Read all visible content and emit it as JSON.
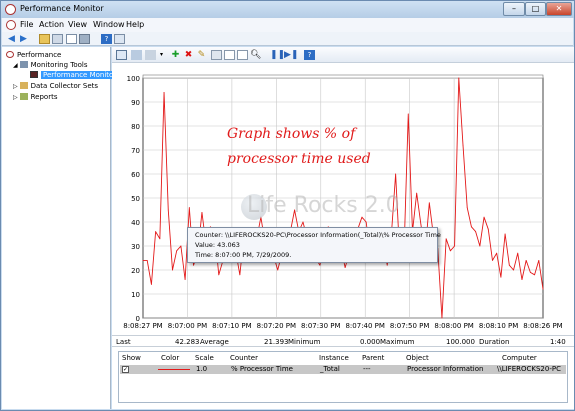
{
  "window": {
    "title": "Performance Monitor",
    "controls": {
      "minimize": "–",
      "maximize": "□",
      "close": "✕"
    }
  },
  "menu": [
    "File",
    "Action",
    "View",
    "Window",
    "Help"
  ],
  "tree": {
    "items": [
      {
        "label": "Performance",
        "level": 0
      },
      {
        "label": "Monitoring Tools",
        "level": 1
      },
      {
        "label": "Performance Monitor",
        "level": 2,
        "selected": true
      },
      {
        "label": "Data Collector Sets",
        "level": 1
      },
      {
        "label": "Reports",
        "level": 1
      }
    ]
  },
  "chart_data": {
    "type": "line",
    "ylim": [
      0,
      100
    ],
    "yticks": [
      0,
      10,
      20,
      30,
      40,
      50,
      60,
      70,
      80,
      90,
      100
    ],
    "x_ticks": [
      "8:08:27 PM",
      "8:07:00 PM",
      "8:07:10 PM",
      "8:07:20 PM",
      "8:07:30 PM",
      "8:07:40 PM",
      "8:07:50 PM",
      "8:08:00 PM",
      "8:08:10 PM",
      "8:08:26 PM"
    ],
    "series": [
      {
        "color": "#e31919",
        "values": [
          24,
          24,
          14,
          36,
          33,
          94,
          45,
          20,
          28,
          30,
          16,
          46,
          22,
          27,
          44,
          30,
          38,
          36,
          18,
          24,
          26,
          25,
          28,
          18,
          35,
          26,
          29,
          33,
          42,
          31,
          25,
          26,
          20,
          27,
          33,
          36,
          45,
          36,
          40,
          33,
          32,
          25,
          22,
          30,
          38,
          28,
          37,
          30,
          21,
          27,
          35,
          37,
          42,
          40,
          26,
          29,
          25,
          32,
          22,
          35,
          60,
          25,
          28,
          85,
          36,
          52,
          39,
          27,
          48,
          34,
          29,
          0,
          33,
          28,
          30,
          100,
          72,
          46,
          38,
          36,
          30,
          42,
          37,
          24,
          27,
          17,
          35,
          22,
          20,
          27,
          16,
          24,
          19,
          18,
          24,
          12
        ]
      }
    ]
  },
  "annotation": {
    "line1": "Graph shows % of",
    "line2": "processor time used"
  },
  "watermark": "Life Rocks 2.0",
  "tooltip": {
    "counter": "Counter: \\\\LIFEROCKS20-PC\\Processor Information(_Total)\\% Processor Time",
    "value": "Value:   43.063",
    "time": "Time:    8:07:00 PM, 7/29/2009."
  },
  "stats": {
    "last_label": "Last",
    "last": "42.283",
    "avg_label": "Average",
    "avg": "21.393",
    "min_label": "Minimum",
    "min": "0.000",
    "max_label": "Maximum",
    "max": "100.000",
    "dur_label": "Duration",
    "dur": "1:40"
  },
  "table": {
    "headers": [
      "Show",
      "Color",
      "Scale",
      "Counter",
      "Instance",
      "Parent",
      "Object",
      "Computer"
    ],
    "rows": [
      {
        "show": "✓",
        "scale": "1.0",
        "counter": "% Processor Time",
        "instance": "_Total",
        "parent": "---",
        "object": "Processor Information",
        "computer": "\\\\LIFEROCKS20-PC"
      }
    ]
  }
}
